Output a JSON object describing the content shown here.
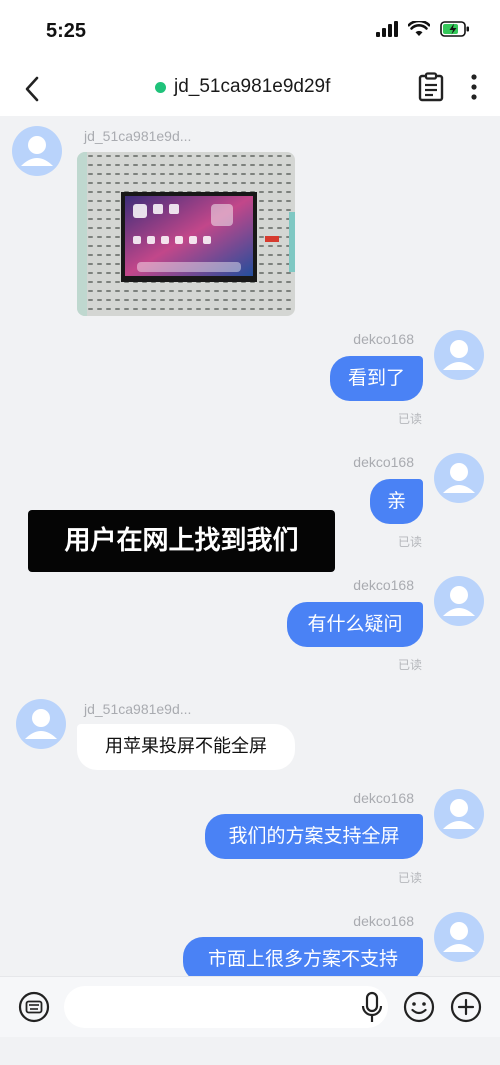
{
  "status": {
    "time": "5:25"
  },
  "header": {
    "title": "jd_51ca981e9d29f"
  },
  "messages": [
    {
      "sender": "jd_51ca981e9d..."
    },
    {
      "sender": "dekco168",
      "text": "看到了",
      "read": "已读"
    },
    {
      "sender": "dekco168",
      "text": "亲",
      "read": "已读"
    },
    {
      "sender": "dekco168",
      "text": "有什么疑问",
      "read": "已读"
    },
    {
      "sender": "jd_51ca981e9d...",
      "text": "用苹果投屏不能全屏"
    },
    {
      "sender": "dekco168",
      "text": "我们的方案支持全屏",
      "read": "已读"
    },
    {
      "sender": "dekco168",
      "text": "市面上很多方案不支持"
    }
  ],
  "overlay": {
    "caption": "用户在网上找到我们"
  },
  "input": {
    "value": "",
    "placeholder": ""
  },
  "colors": {
    "accent": "#4a82f5",
    "online": "#1fc27a",
    "avatar": "#b9d3fb"
  },
  "icons": [
    "back-arrow-icon",
    "orders-clipboard-icon",
    "more-icon",
    "keyboard-icon",
    "microphone-icon",
    "emoji-icon",
    "plus-icon",
    "user-avatar-icon"
  ]
}
